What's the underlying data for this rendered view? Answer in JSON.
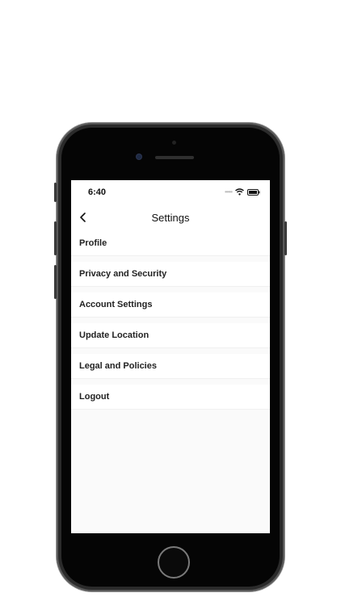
{
  "status_bar": {
    "time": "6:40",
    "signal_icon": "signal-dots-icon",
    "wifi_icon": "wifi-icon",
    "battery_icon": "battery-icon"
  },
  "nav": {
    "title": "Settings",
    "back_icon": "chevron-left-icon"
  },
  "menu": {
    "items": [
      {
        "label": "Profile"
      },
      {
        "label": "Privacy and Security"
      },
      {
        "label": "Account Settings"
      },
      {
        "label": "Update Location"
      },
      {
        "label": "Legal and Policies"
      },
      {
        "label": "Logout"
      }
    ]
  },
  "colors": {
    "screen_background": "#fafafa",
    "item_background": "#ffffff",
    "text": "#222222",
    "device_frame": "#2b2b2b"
  }
}
